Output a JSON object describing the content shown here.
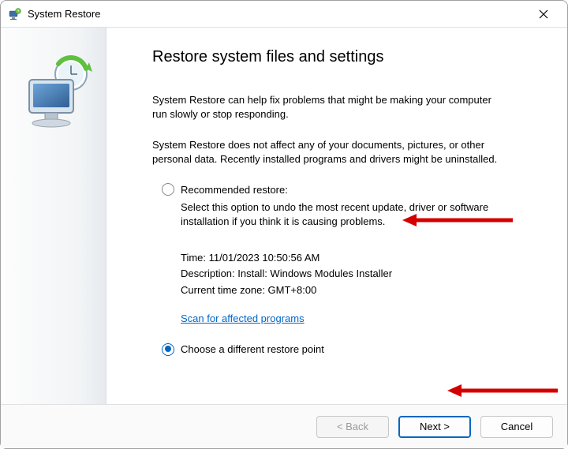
{
  "window": {
    "title": "System Restore"
  },
  "heading": "Restore system files and settings",
  "intro1": "System Restore can help fix problems that might be making your computer run slowly or stop responding.",
  "intro2": "System Restore does not affect any of your documents, pictures, or other personal data. Recently installed programs and drivers might be uninstalled.",
  "option1": {
    "label": "Recommended restore:",
    "description": "Select this option to undo the most recent update, driver or software installation if you think it is causing problems.",
    "time_label": "Time: ",
    "time_value": "11/01/2023 10:50:56 AM",
    "desc_label": "Description: ",
    "desc_value": "Install: Windows Modules Installer",
    "tz_label": "Current time zone: ",
    "tz_value": "GMT+8:00",
    "scan_link": "Scan for affected programs"
  },
  "option2": {
    "label": "Choose a different restore point"
  },
  "buttons": {
    "back": "< Back",
    "next": "Next >",
    "cancel": "Cancel"
  }
}
